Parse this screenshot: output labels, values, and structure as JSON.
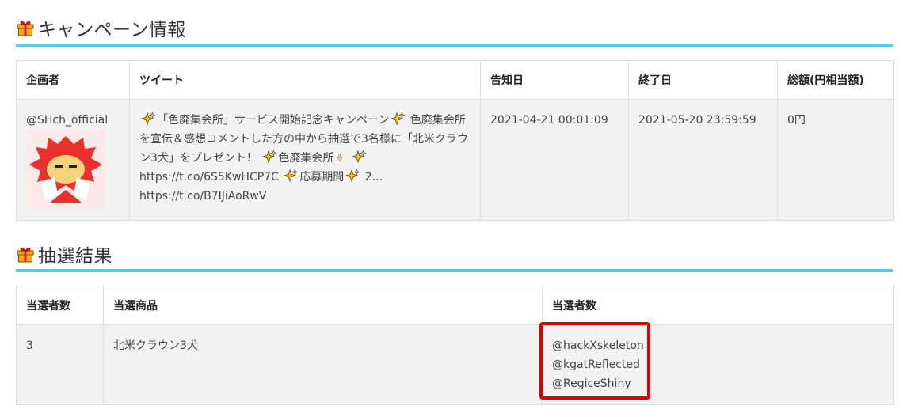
{
  "campaign": {
    "heading": "キャンペーン情報",
    "columns": [
      "企画者",
      "ツイート",
      "告知日",
      "終了日",
      "総額(円相当額)"
    ],
    "row": {
      "organizer": "@SHch_official",
      "tweet_segments": [
        {
          "type": "icon",
          "name": "sparkles-icon"
        },
        {
          "type": "text",
          "value": "「色廃集会所」サービス開始記念キャンペーン"
        },
        {
          "type": "icon",
          "name": "sparkles-icon"
        },
        {
          "type": "text",
          "value": " 色廃集会所を宣伝＆感想コメントした方の中から抽選で3名様に「北米クラウン3犬」をプレゼント！ "
        },
        {
          "type": "icon",
          "name": "sparkles-icon"
        },
        {
          "type": "text",
          "value": "色廃集会所"
        },
        {
          "type": "icon",
          "name": "pointing-down-icon"
        },
        {
          "type": "text",
          "value": " "
        },
        {
          "type": "icon",
          "name": "sparkles-icon"
        },
        {
          "type": "text",
          "value": " https://t.co/6S5KwHCP7C "
        },
        {
          "type": "icon",
          "name": "sparkles-icon"
        },
        {
          "type": "text",
          "value": "応募期間"
        },
        {
          "type": "icon",
          "name": "sparkles-icon"
        },
        {
          "type": "text",
          "value": " 2... https://t.co/B7IJiAoRwV"
        }
      ],
      "announce_date": "2021-04-21 00:01:09",
      "end_date": "2021-05-20 23:59:59",
      "total": "0円"
    }
  },
  "lottery": {
    "heading": "抽選結果",
    "columns": [
      "当選者数",
      "当選商品",
      "当選者数"
    ],
    "row": {
      "count": "3",
      "prize": "北米クラウン3犬",
      "winners": [
        "@hackXskeleton",
        "@kgatReflected",
        "@RegiceShiny"
      ]
    }
  },
  "colors": {
    "accent_rule": "#5bc8e8",
    "highlight_box": "#e00000"
  }
}
